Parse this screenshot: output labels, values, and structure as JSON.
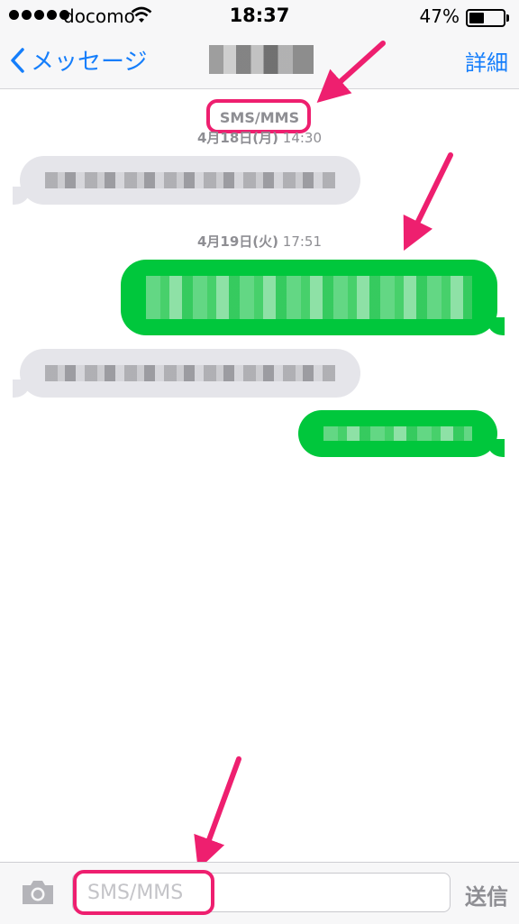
{
  "status_bar": {
    "carrier": "docomo",
    "time": "18:37",
    "battery": "47%",
    "battery_level": 0.47
  },
  "nav": {
    "back_label": "メッセージ",
    "detail_label": "詳細"
  },
  "conversation": {
    "service_label": "SMS/MMS",
    "timestamps": [
      {
        "date": "4月18日(月)",
        "time": "14:30"
      },
      {
        "date": "4月19日(火)",
        "time": "17:51"
      }
    ]
  },
  "input": {
    "placeholder": "SMS/MMS",
    "send_label": "送信"
  },
  "colors": {
    "accent": "#157efb",
    "sent_bubble": "#00c73c",
    "received_bubble": "#e5e5ea",
    "annotation": "#ee1f6f"
  },
  "icons": [
    "back-chevron-icon",
    "wifi-icon",
    "battery-icon",
    "camera-icon",
    "annotation-arrow-icon"
  ]
}
